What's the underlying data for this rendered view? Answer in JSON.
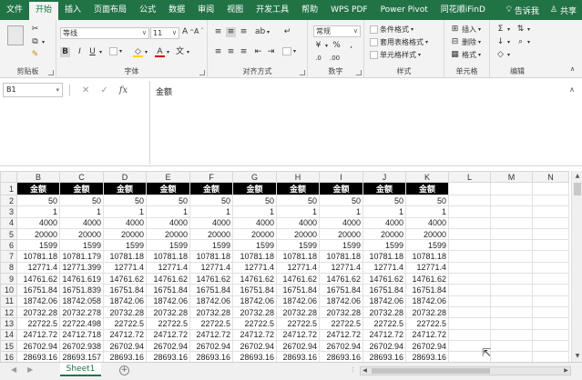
{
  "tabs": [
    "文件",
    "开始",
    "插入",
    "页面布局",
    "公式",
    "数据",
    "审阅",
    "视图",
    "开发工具",
    "帮助",
    "WPS PDF",
    "Power Pivot",
    "同花顺iFinD"
  ],
  "active_tab": "开始",
  "tell_me": "告诉我",
  "share": "共享",
  "ribbon": {
    "clipboard_label": "剪贴板",
    "font_label": "字体",
    "font_name": "等线",
    "font_size": "11",
    "align_label": "对齐方式",
    "number_label": "数字",
    "number_format": "常规",
    "styles_label": "样式",
    "cond_format": "条件格式",
    "table_format": "套用表格格式",
    "cell_style": "单元格样式",
    "cells_label": "单元格",
    "insert": "插入",
    "delete": "删除",
    "format": "格式",
    "editing_label": "编辑"
  },
  "formula_bar": {
    "name_box": "B1",
    "content": "金额"
  },
  "grid": {
    "columns": [
      "B",
      "C",
      "D",
      "E",
      "F",
      "G",
      "H",
      "I",
      "J",
      "K",
      "L",
      "M",
      "N"
    ],
    "header_text": "金额",
    "rows": [
      {
        "n": "1",
        "cells": [
          "金额",
          "金额",
          "金额",
          "金额",
          "金额",
          "金额",
          "金额",
          "金额",
          "金额",
          "金额"
        ]
      },
      {
        "n": "2",
        "cells": [
          "50",
          "50",
          "50",
          "50",
          "50",
          "50",
          "50",
          "50",
          "50",
          "50"
        ]
      },
      {
        "n": "3",
        "cells": [
          "1",
          "1",
          "1",
          "1",
          "1",
          "1",
          "1",
          "1",
          "1",
          "1"
        ]
      },
      {
        "n": "4",
        "cells": [
          "4000",
          "4000",
          "4000",
          "4000",
          "4000",
          "4000",
          "4000",
          "4000",
          "4000",
          "4000"
        ]
      },
      {
        "n": "5",
        "cells": [
          "20000",
          "20000",
          "20000",
          "20000",
          "20000",
          "20000",
          "20000",
          "20000",
          "20000",
          "20000"
        ]
      },
      {
        "n": "6",
        "cells": [
          "1599",
          "1599",
          "1599",
          "1599",
          "1599",
          "1599",
          "1599",
          "1599",
          "1599",
          "1599"
        ]
      },
      {
        "n": "7",
        "cells": [
          "10781.18",
          "10781.179",
          "10781.18",
          "10781.18",
          "10781.18",
          "10781.18",
          "10781.18",
          "10781.18",
          "10781.18",
          "10781.18"
        ]
      },
      {
        "n": "8",
        "cells": [
          "12771.4",
          "12771.399",
          "12771.4",
          "12771.4",
          "12771.4",
          "12771.4",
          "12771.4",
          "12771.4",
          "12771.4",
          "12771.4"
        ]
      },
      {
        "n": "9",
        "cells": [
          "14761.62",
          "14761.619",
          "14761.62",
          "14761.62",
          "14761.62",
          "14761.62",
          "14761.62",
          "14761.62",
          "14761.62",
          "14761.62"
        ]
      },
      {
        "n": "10",
        "cells": [
          "16751.84",
          "16751.839",
          "16751.84",
          "16751.84",
          "16751.84",
          "16751.84",
          "16751.84",
          "16751.84",
          "16751.84",
          "16751.84"
        ]
      },
      {
        "n": "11",
        "cells": [
          "18742.06",
          "18742.058",
          "18742.06",
          "18742.06",
          "18742.06",
          "18742.06",
          "18742.06",
          "18742.06",
          "18742.06",
          "18742.06"
        ]
      },
      {
        "n": "12",
        "cells": [
          "20732.28",
          "20732.278",
          "20732.28",
          "20732.28",
          "20732.28",
          "20732.28",
          "20732.28",
          "20732.28",
          "20732.28",
          "20732.28"
        ]
      },
      {
        "n": "13",
        "cells": [
          "22722.5",
          "22722.498",
          "22722.5",
          "22722.5",
          "22722.5",
          "22722.5",
          "22722.5",
          "22722.5",
          "22722.5",
          "22722.5"
        ]
      },
      {
        "n": "14",
        "cells": [
          "24712.72",
          "24712.718",
          "24712.72",
          "24712.72",
          "24712.72",
          "24712.72",
          "24712.72",
          "24712.72",
          "24712.72",
          "24712.72"
        ]
      },
      {
        "n": "15",
        "cells": [
          "26702.94",
          "26702.938",
          "26702.94",
          "26702.94",
          "26702.94",
          "26702.94",
          "26702.94",
          "26702.94",
          "26702.94",
          "26702.94"
        ]
      },
      {
        "n": "16",
        "cells": [
          "28693.16",
          "28693.157",
          "28693.16",
          "28693.16",
          "28693.16",
          "28693.16",
          "28693.16",
          "28693.16",
          "28693.16",
          "28693.16"
        ]
      }
    ]
  },
  "sheet_tab": "Sheet1",
  "colors": {
    "accent": "#217346",
    "header_bg": "#000000",
    "header_text": "#ffffff"
  }
}
